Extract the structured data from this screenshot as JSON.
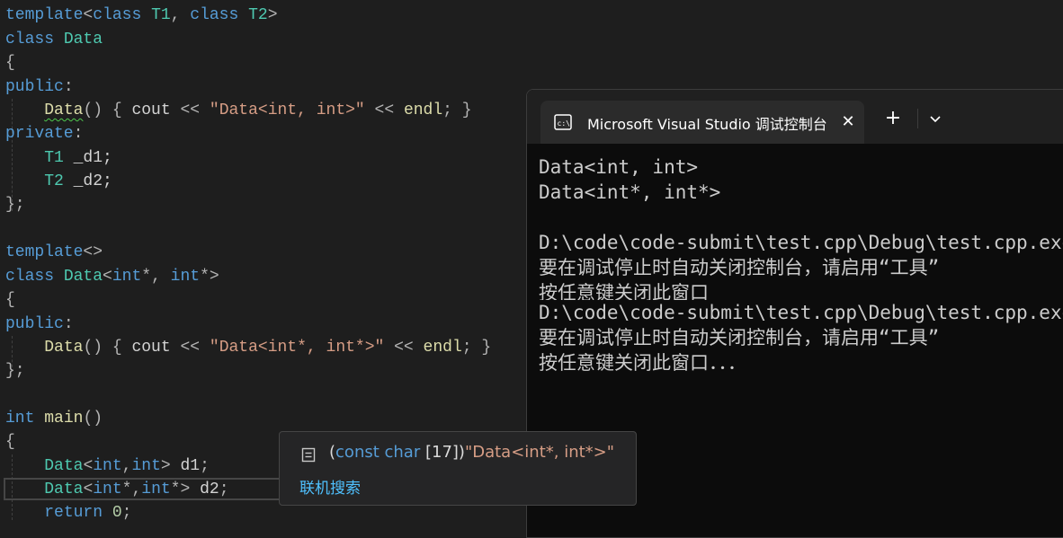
{
  "editor": {
    "line1": {
      "kw1": "template",
      "p1": "<",
      "kw2": "class",
      "t1": "T1",
      "p2": ", ",
      "kw3": "class",
      "t2": "T2",
      "p3": ">"
    },
    "line2": {
      "kw": "class",
      "name": "Data"
    },
    "line3": {
      "brace": "{"
    },
    "line4": {
      "kw": "public",
      "colon": ":"
    },
    "line5": {
      "fn": "Data",
      "a": "() { ",
      "cout": "cout",
      "op1": " << ",
      "str": "\"Data<int, int>\"",
      "op2": " << ",
      "endl": "endl",
      "end": "; }"
    },
    "line6": {
      "kw": "private",
      "colon": ":"
    },
    "line7": {
      "ty": "T1",
      "rest": " _d1;"
    },
    "line8": {
      "ty": "T2",
      "rest": " _d2;"
    },
    "line9": {
      "brace": "};"
    },
    "line11": {
      "kw": "template",
      "p": "<>"
    },
    "line12": {
      "kw": "class",
      "name": "Data",
      "p1": "<",
      "a1": "int",
      "s1": "*, ",
      "a2": "int",
      "s2": "*>"
    },
    "line13": {
      "brace": "{"
    },
    "line14": {
      "kw": "public",
      "colon": ":"
    },
    "line15": {
      "fn": "Data",
      "a": "() { ",
      "cout": "cout",
      "op1": " << ",
      "str": "\"Data<int*, int*>\"",
      "op2": " << ",
      "endl": "endl",
      "end": "; }"
    },
    "line16": {
      "brace": "};"
    },
    "line18": {
      "kw": "int",
      "fn": "main",
      "p": "()"
    },
    "line19": {
      "brace": "{"
    },
    "line20": {
      "ty": "Data",
      "p1": "<",
      "a1": "int",
      "c": ",",
      "a2": "int",
      "p2": "> ",
      "var": "d1",
      "end": ";"
    },
    "line21": {
      "ty": "Data",
      "p1": "<",
      "a1": "int",
      "c": "*,",
      "a2": "int",
      "p2": "*> ",
      "var": "d2",
      "end": ";"
    },
    "line22": {
      "kw": "return",
      "num": "0",
      "end": ";"
    }
  },
  "console": {
    "tab_title": "Microsoft Visual Studio 调试控制台",
    "close_glyph": "✕",
    "new_tab_glyph": "+",
    "output_lines": [
      "Data<int, int>",
      "Data<int*, int*>",
      "",
      "D:\\code\\code-submit\\test.cpp\\Debug\\test.cpp.exe",
      "要在调试停止时自动关闭控制台，请启用“工具”",
      "按任意键关闭此窗口",
      "D:\\code\\code-submit\\test.cpp\\Debug\\test.cpp.exe",
      "要在调试停止时自动关闭控制台，请启用“工具”",
      "按任意键关闭此窗口．．．"
    ]
  },
  "tooltip": {
    "paren_open": "(",
    "type": "const char",
    "size": " [17])",
    "value": "\"Data<int*, int*>\"",
    "link": "联机搜索"
  },
  "colors": {
    "editor_bg": "#1e1e1e",
    "keyword": "#569cd6",
    "type": "#4ec9b0",
    "function": "#dcdcaa",
    "string": "#d69d85",
    "console_bg": "#0c0c0c",
    "link": "#4fc1ff"
  }
}
